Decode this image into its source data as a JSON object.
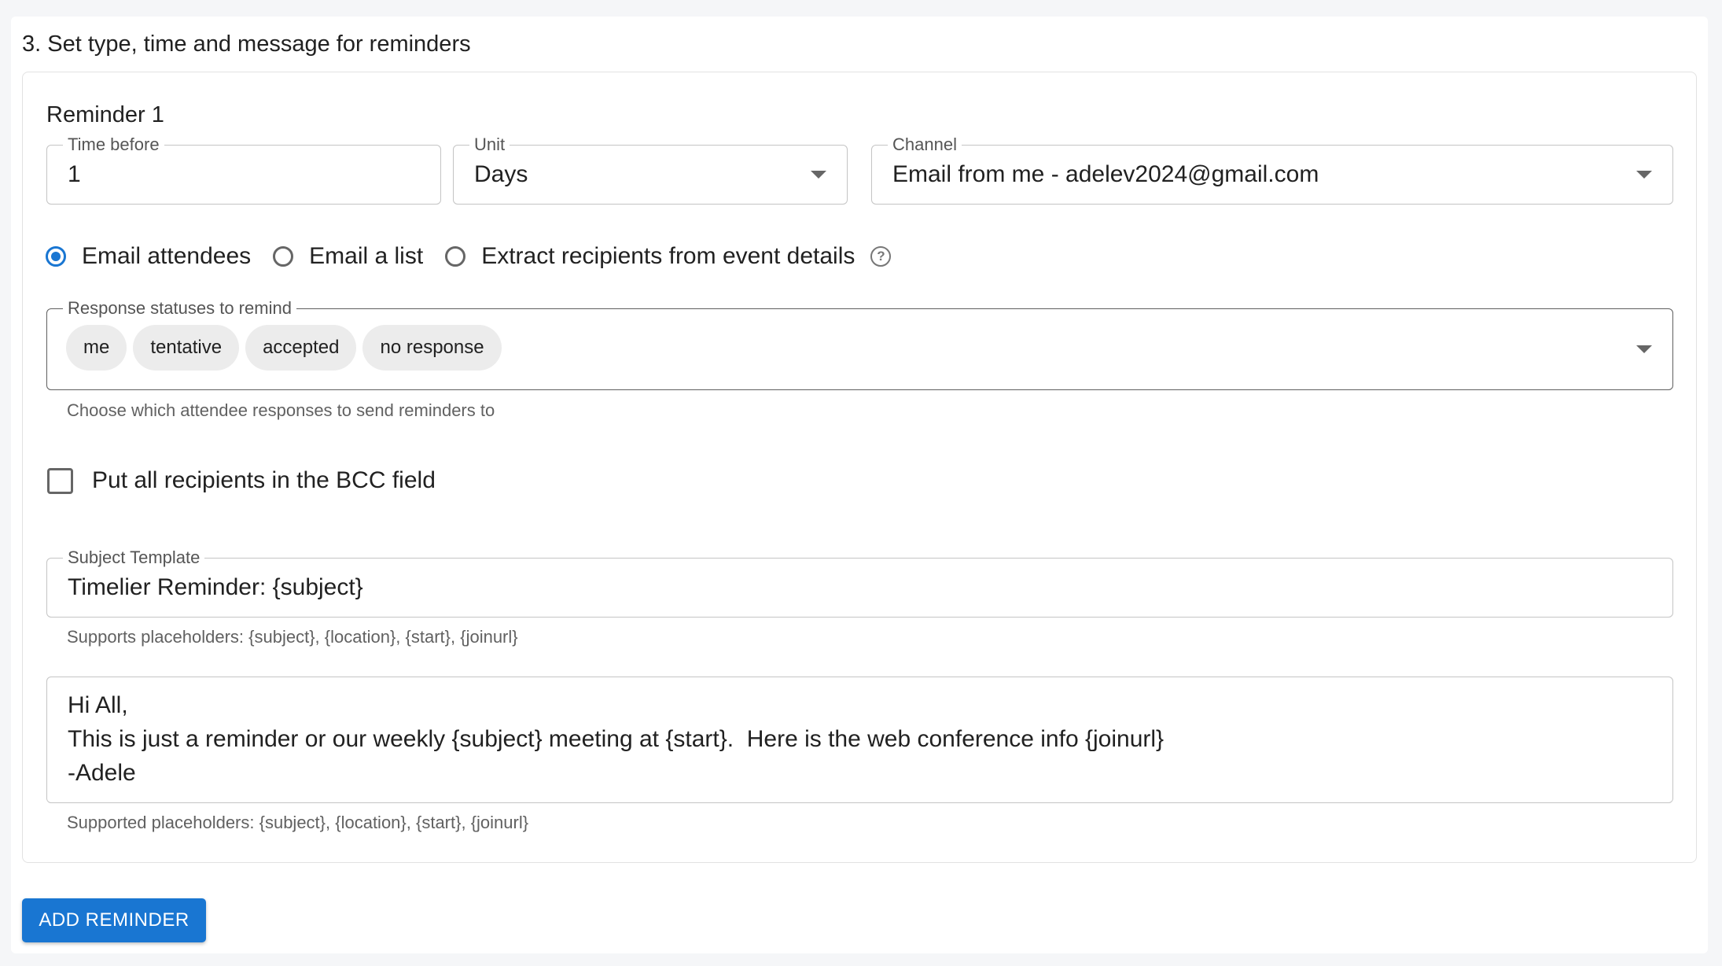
{
  "section": {
    "title": "3. Set type, time and message for reminders"
  },
  "reminder": {
    "title": "Reminder 1",
    "time_before": {
      "label": "Time before",
      "value": "1"
    },
    "unit": {
      "label": "Unit",
      "value": "Days"
    },
    "channel": {
      "label": "Channel",
      "value": "Email from me - adelev2024@gmail.com"
    },
    "recipient_options": [
      {
        "label": "Email attendees",
        "checked": true
      },
      {
        "label": "Email a list",
        "checked": false
      },
      {
        "label": "Extract recipients from event details",
        "checked": false
      }
    ],
    "response_statuses": {
      "label": "Response statuses to remind",
      "chips": [
        "me",
        "tentative",
        "accepted",
        "no response"
      ],
      "helper": "Choose which attendee responses to send reminders to"
    },
    "bcc": {
      "label": "Put all recipients in the BCC field",
      "checked": false
    },
    "subject": {
      "label": "Subject Template",
      "value": "Timelier Reminder: {subject}",
      "helper": "Supports placeholders: {subject}, {location}, {start}, {joinurl}"
    },
    "message": {
      "value": "Hi All,\nThis is just a reminder or our weekly {subject} meeting at {start}.  Here is the web conference info {joinurl}\n-Adele",
      "helper": "Supported placeholders: {subject}, {location}, {start}, {joinurl}"
    }
  },
  "actions": {
    "add_reminder": "ADD REMINDER"
  },
  "colors": {
    "accent": "#1976d2"
  },
  "icons": {
    "help": "help-circle-icon",
    "dropdown": "arrow-drop-down-icon"
  }
}
